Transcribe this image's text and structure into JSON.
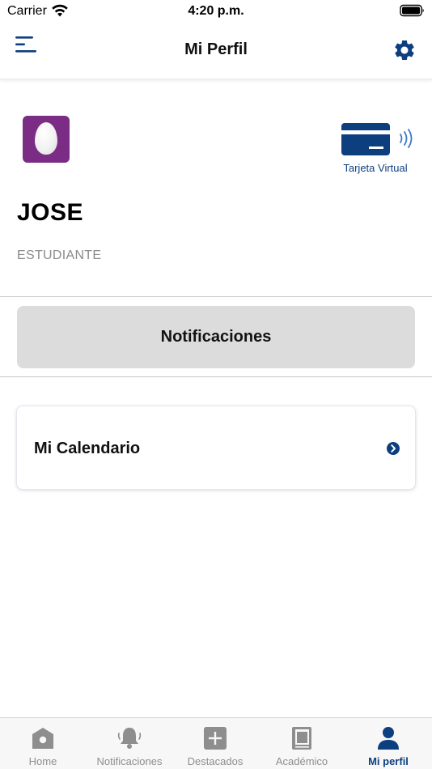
{
  "status_bar": {
    "carrier": "Carrier",
    "time": "4:20 p.m."
  },
  "nav": {
    "title": "Mi Perfil",
    "menu_icon": "hamburger-menu-icon",
    "settings_icon": "gear-icon"
  },
  "profile": {
    "name": "JOSE",
    "role": "ESTUDIANTE",
    "avatar_icon": "egg-avatar",
    "virtual_card_label": "Tarjeta Virtual"
  },
  "actions": {
    "notifications_label": "Notificaciones",
    "calendar_label": "Mi Calendario"
  },
  "tabs": [
    {
      "label": "Home",
      "icon": "home-icon",
      "active": false
    },
    {
      "label": "Notificaciones",
      "icon": "bell-icon",
      "active": false
    },
    {
      "label": "Destacados",
      "icon": "plus-square-icon",
      "active": false
    },
    {
      "label": "Académico",
      "icon": "book-icon",
      "active": false
    },
    {
      "label": "Mi perfil",
      "icon": "user-icon",
      "active": true
    }
  ],
  "colors": {
    "accent": "#0d3f7f",
    "avatar_bg": "#7b2c85",
    "button_bg": "#dcdcdc",
    "tab_inactive": "#8e8e8e"
  }
}
